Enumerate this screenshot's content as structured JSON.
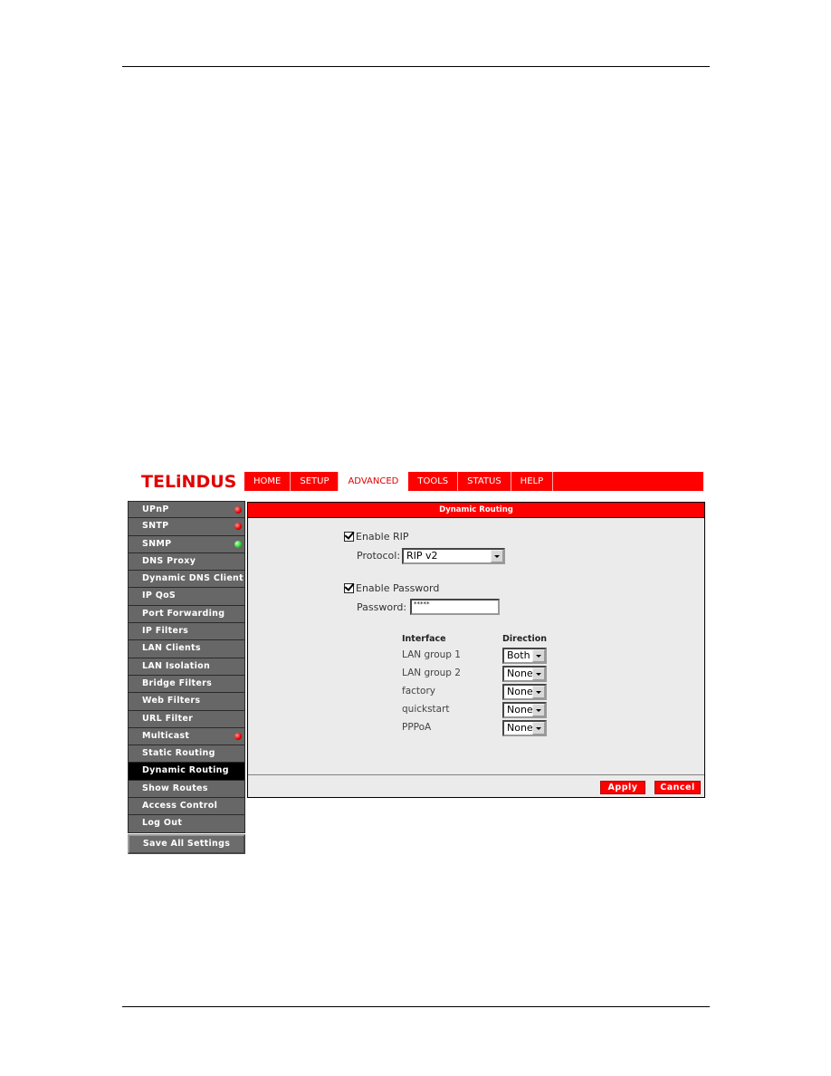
{
  "brand": {
    "logo_text": "TELiNDUS",
    "accent_color": "#ff0000"
  },
  "nav": {
    "tabs": [
      {
        "label": "HOME",
        "active": false
      },
      {
        "label": "SETUP",
        "active": false
      },
      {
        "label": "ADVANCED",
        "active": true
      },
      {
        "label": "TOOLS",
        "active": false
      },
      {
        "label": "STATUS",
        "active": false
      },
      {
        "label": "HELP",
        "active": false
      }
    ]
  },
  "sidebar": {
    "items": [
      {
        "label": "UPnP",
        "status": "red"
      },
      {
        "label": "SNTP",
        "status": "red"
      },
      {
        "label": "SNMP",
        "status": "green"
      },
      {
        "label": "DNS Proxy",
        "status": null
      },
      {
        "label": "Dynamic DNS Client",
        "status": null
      },
      {
        "label": "IP QoS",
        "status": null
      },
      {
        "label": "Port Forwarding",
        "status": null
      },
      {
        "label": "IP Filters",
        "status": null
      },
      {
        "label": "LAN Clients",
        "status": null
      },
      {
        "label": "LAN Isolation",
        "status": null
      },
      {
        "label": "Bridge Filters",
        "status": null
      },
      {
        "label": "Web Filters",
        "status": null
      },
      {
        "label": "URL Filter",
        "status": null
      },
      {
        "label": "Multicast",
        "status": "red"
      },
      {
        "label": "Static Routing",
        "status": null
      },
      {
        "label": "Dynamic Routing",
        "status": null,
        "active": true
      },
      {
        "label": "Show Routes",
        "status": null
      },
      {
        "label": "Access Control",
        "status": null
      },
      {
        "label": "Log Out",
        "status": null
      }
    ],
    "save_label": "Save All Settings"
  },
  "panel": {
    "title": "Dynamic Routing",
    "enable_rip": {
      "label": "Enable RIP",
      "checked": true
    },
    "protocol": {
      "label": "Protocol:",
      "value": "RIP v2"
    },
    "enable_password": {
      "label": "Enable Password",
      "checked": true
    },
    "password": {
      "label": "Password:",
      "value": "*****"
    },
    "table": {
      "headers": {
        "interface": "Interface",
        "direction": "Direction"
      },
      "rows": [
        {
          "interface": "LAN group 1",
          "direction": "Both"
        },
        {
          "interface": "LAN group 2",
          "direction": "None"
        },
        {
          "interface": "factory",
          "direction": "None"
        },
        {
          "interface": "quickstart",
          "direction": "None"
        },
        {
          "interface": "PPPoA",
          "direction": "None"
        }
      ]
    },
    "apply_label": "Apply",
    "cancel_label": "Cancel"
  }
}
